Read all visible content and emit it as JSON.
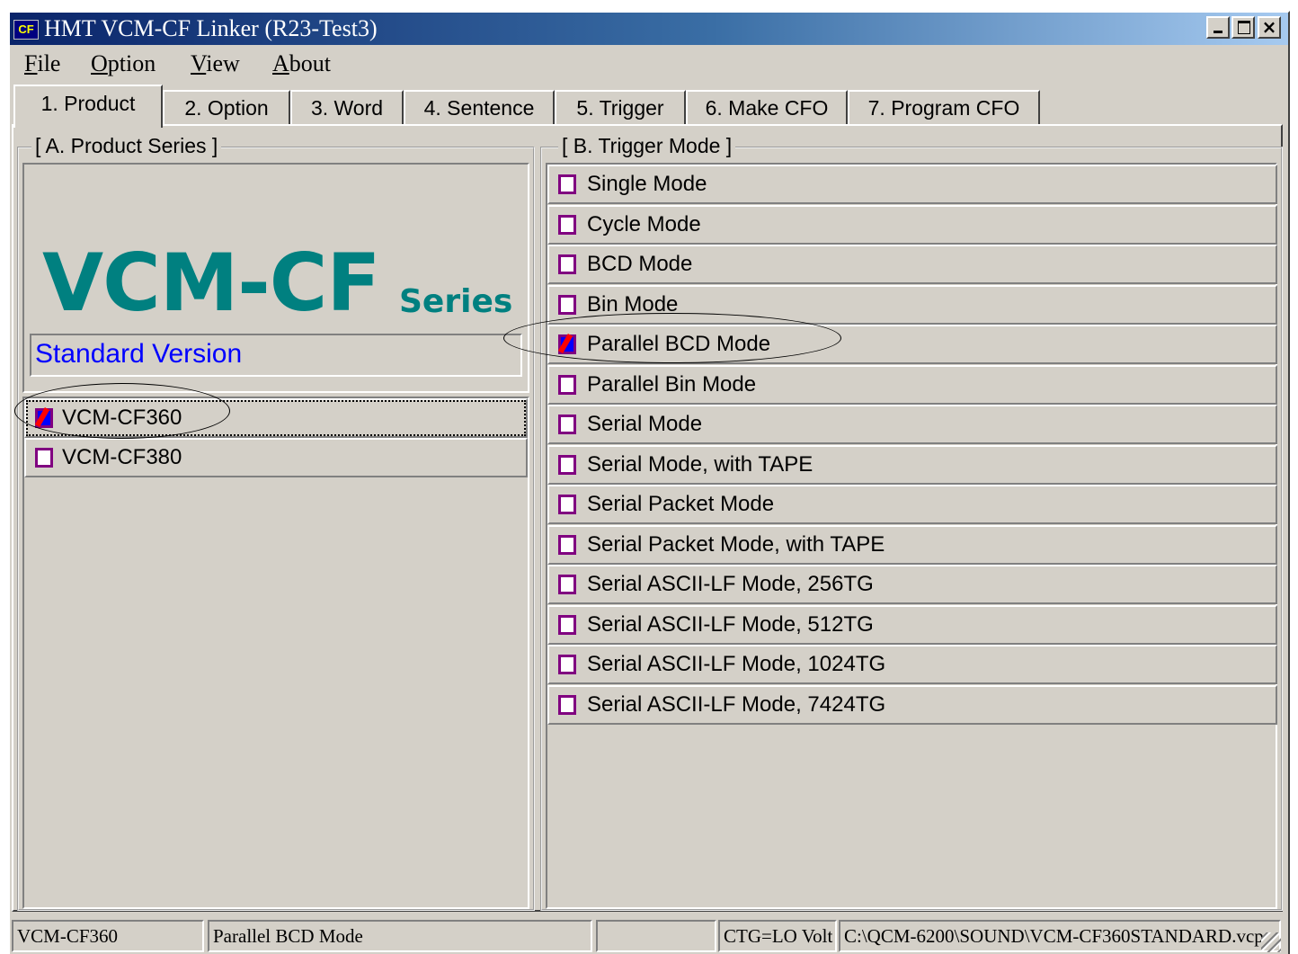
{
  "window": {
    "title": "HMT VCM-CF Linker (R23-Test3)",
    "icon_text": "CF",
    "controls": [
      "minimize-icon",
      "maximize-icon",
      "close-icon"
    ],
    "close_glyph": "×"
  },
  "menu": [
    "File",
    "Option",
    "View",
    "About"
  ],
  "menu_accel": [
    "F",
    "O",
    "V",
    "A"
  ],
  "menu_rest": [
    "ile",
    "ption",
    "iew",
    "bout"
  ],
  "tabs": [
    "1. Product",
    "2. Option",
    "3. Word",
    "4. Sentence",
    "5. Trigger",
    "6. Make CFO",
    "7. Program CFO"
  ],
  "active_tab": "1. Product",
  "product_series": {
    "title": "[ A. Product Series ]",
    "logo_main": "VCM-CF",
    "logo_suffix": "Series",
    "version": "Standard Version",
    "items": [
      {
        "label": "VCM-CF360",
        "checked": true
      },
      {
        "label": "VCM-CF380",
        "checked": false
      }
    ]
  },
  "trigger_mode": {
    "title": "[ B. Trigger Mode ]",
    "items": [
      {
        "label": "Single Mode",
        "checked": false
      },
      {
        "label": "Cycle Mode",
        "checked": false
      },
      {
        "label": "BCD Mode",
        "checked": false
      },
      {
        "label": "Bin Mode",
        "checked": false
      },
      {
        "label": "Parallel BCD Mode",
        "checked": true
      },
      {
        "label": "Parallel Bin Mode",
        "checked": false
      },
      {
        "label": "Serial Mode",
        "checked": false
      },
      {
        "label": "Serial Mode, with TAPE",
        "checked": false
      },
      {
        "label": "Serial Packet Mode",
        "checked": false
      },
      {
        "label": "Serial Packet Mode, with TAPE",
        "checked": false
      },
      {
        "label": "Serial ASCII-LF Mode, 256TG",
        "checked": false
      },
      {
        "label": "Serial ASCII-LF Mode, 512TG",
        "checked": false
      },
      {
        "label": "Serial ASCII-LF Mode, 1024TG",
        "checked": false
      },
      {
        "label": "Serial ASCII-LF Mode, 7424TG",
        "checked": false
      }
    ]
  },
  "statusbar": {
    "product": "VCM-CF360",
    "mode": "Parallel BCD Mode",
    "blank": "",
    "ctg": "CTG=LO Volt",
    "path": "C:\\QCM-6200\\SOUND\\VCM-CF360STANDARD.vcp"
  },
  "colors": {
    "face": "#d4d0c8",
    "title_start": "#0a246a",
    "title_end": "#a6caf0",
    "logo": "#008080",
    "version_text": "#0000ff",
    "checkbox_border": "#800080"
  }
}
